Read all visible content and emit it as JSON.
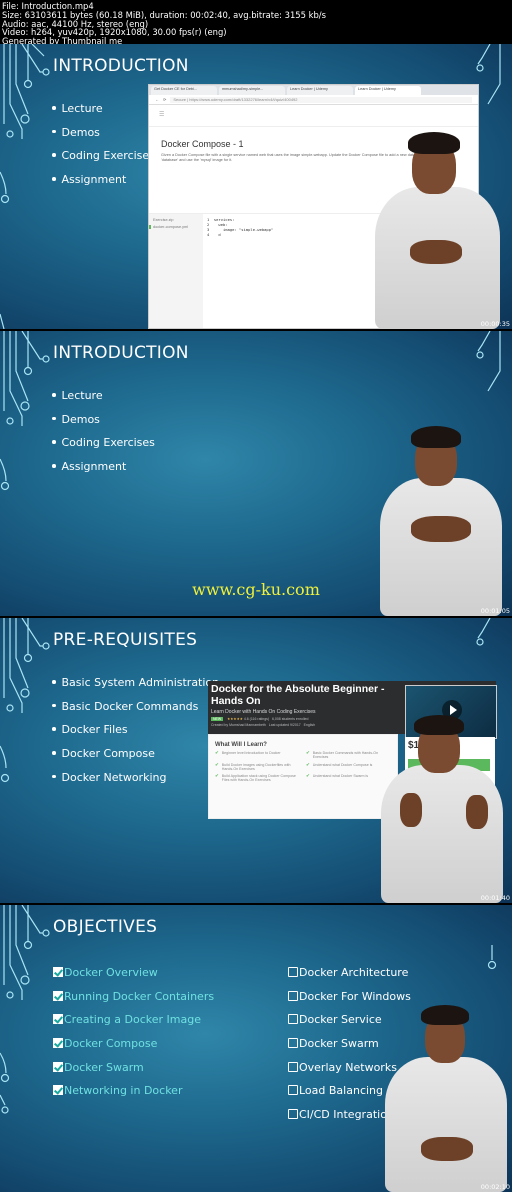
{
  "header": {
    "lines": [
      "File: Introduction.mp4",
      "Size: 63103611 bytes (60.18 MiB), duration: 00:02:40, avg.bitrate: 3155 kb/s",
      "Audio: aac, 44100 Hz, stereo (eng)",
      "Video: h264, yuv420p, 1920x1080, 30.00 fps(r) (eng)",
      "Generated by Thumbnail me"
    ]
  },
  "frames": [
    {
      "title": "INTRODUCTION",
      "bullets": [
        "Lecture",
        "Demos",
        "Coding Exercises",
        "Assignment"
      ],
      "timestamp": "00:00:35",
      "browser": {
        "tabs": [
          "Get Docker CE for Debi...",
          "mmumshad/my-simple...",
          "Learn Docker | Udemy",
          "Learn Docker | Udemy"
        ],
        "address": "Secure | https://www.udemy.com/draft/1332276/learn/v4/t/quiz/400492",
        "exercise_title": "Docker Compose - 1",
        "exercise_desc": "Given a Docker Compose file with a single service named web that uses the image simple-webapp. Update the Docker Compose file to add a new database service named 'database' and use the 'mysql' image for it.",
        "panel_label": "Exercise.zip",
        "file_name": "docker-compose.yml",
        "code": "1  services:\n2    web:\n3      image: \"simple-webapp\"\n4    d"
      }
    },
    {
      "title": "INTRODUCTION",
      "bullets": [
        "Lecture",
        "Demos",
        "Coding Exercises",
        "Assignment"
      ],
      "timestamp": "00:01:05",
      "watermark": "www.cg-ku.com"
    },
    {
      "title": "PRE-REQUISITES",
      "bullets": [
        "Basic System Administration",
        "Basic Docker Commands",
        "Docker Files",
        "Docker Compose",
        "Docker Networking"
      ],
      "timestamp": "00:01:40",
      "udemy": {
        "course_title": "Docker for the Absolute Beginner - Hands On",
        "subtitle": "Learn Docker with Hands On Coding Exercises",
        "badge": "NEW",
        "stars": "★★★★★",
        "rating": "4.6 (116 ratings)",
        "students": "6,008 students enrolled",
        "created": "Created by Mumshad Mannambeth",
        "updated": "Last updated 9/2017",
        "language": "English",
        "learn_title": "What Will I Learn?",
        "learn_items": [
          "Beginner level introduction to Docker",
          "Basic Docker Commands with Hands-On Exercises",
          "Build Docker images using Dockerfiles with Hands-On Exercises",
          "Understand what Docker Compose is",
          "Build Application stack using Docker Compose Files with Hands-On Exercises",
          "Understand what Docker Swarm is"
        ],
        "price": "$1"
      }
    },
    {
      "title": "OBJECTIVES",
      "timestamp": "00:02:10",
      "done": [
        "Docker Overview",
        "Running Docker Containers",
        "Creating a Docker Image",
        "Docker Compose",
        "Docker Swarm",
        "Networking in Docker"
      ],
      "todo": [
        "Docker Architecture",
        "Docker For Windows",
        "Docker Service",
        "Docker Swarm",
        "Overlay Networks",
        "Load Balancing",
        "CI/CD Integration"
      ]
    }
  ],
  "colors": {
    "slide_bg": "#1f6b90",
    "checked_text": "#6fe0e0",
    "watermark": "#f0f03a",
    "udemy_green": "#5cb85c"
  }
}
